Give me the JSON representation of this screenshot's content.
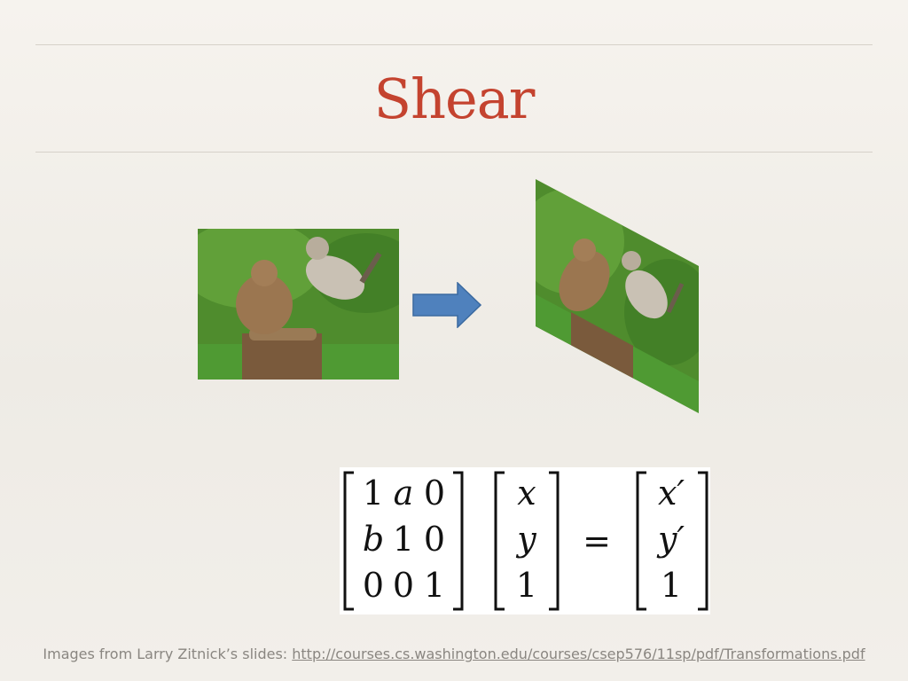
{
  "slide": {
    "title": "Shear",
    "matrix": {
      "rows": [
        [
          "1",
          "a",
          "0"
        ],
        [
          "b",
          "1",
          "0"
        ],
        [
          "0",
          "0",
          "1"
        ]
      ],
      "vector": [
        "x",
        "y",
        "1"
      ],
      "equals": "=",
      "result": [
        "x′",
        "y′",
        "1"
      ]
    },
    "footer": {
      "prefix": "Images from Larry Zitnick’s slides: ",
      "link": "http://courses.cs.washington.edu/courses/csep576/11sp/pdf/Transformations.pdf"
    }
  },
  "colors": {
    "title": "#c4432f",
    "arrow_fill": "#4f81bd",
    "arrow_stroke": "#3b6aa0",
    "footer": "#8a8681"
  },
  "icons": [
    "right-arrow-icon"
  ]
}
